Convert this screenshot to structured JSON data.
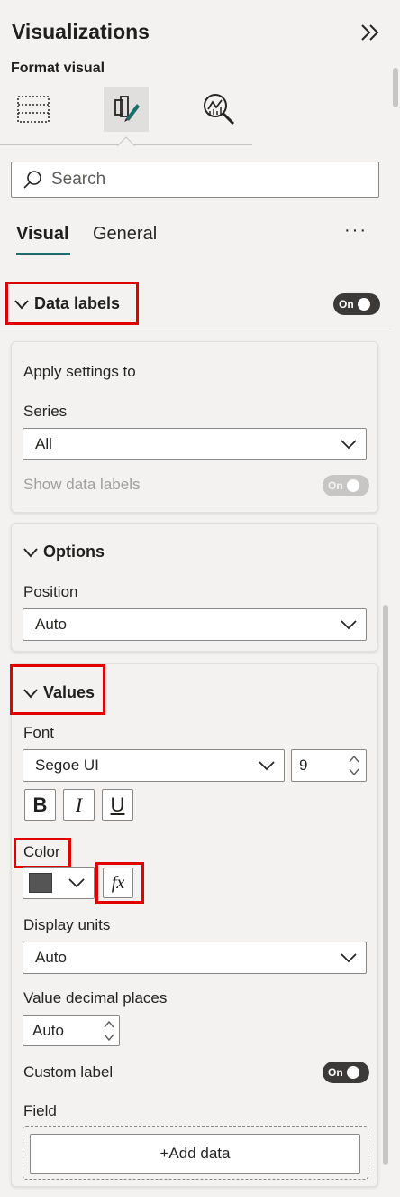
{
  "header": {
    "title": "Visualizations",
    "subtitle": "Format visual",
    "collapse_icon": "double-chevron-right-icon"
  },
  "view_icons": [
    "build-visual-grid-icon",
    "format-brush-icon",
    "analytics-magnifier-icon"
  ],
  "search": {
    "placeholder": "Search"
  },
  "format_tabs": {
    "visual": "Visual",
    "general": "General",
    "more": "···"
  },
  "data_labels": {
    "title": "Data labels",
    "toggle": "On"
  },
  "apply_settings": {
    "title": "Apply settings to",
    "series_label": "Series",
    "series_value": "All",
    "show_label": "Show data labels",
    "show_toggle": "On"
  },
  "options": {
    "title": "Options",
    "position_label": "Position",
    "position_value": "Auto"
  },
  "values": {
    "title": "Values",
    "font_label": "Font",
    "font_family": "Segoe UI",
    "font_size": "9",
    "bold": "B",
    "italic": "I",
    "underline": "U",
    "color_label": "Color",
    "color_swatch": "#555555",
    "fx": "fx",
    "display_units_label": "Display units",
    "display_units_value": "Auto",
    "decimal_label": "Value decimal places",
    "decimal_value": "Auto",
    "custom_label": "Custom label",
    "custom_toggle": "On",
    "field_label": "Field",
    "add_data": "+Add data"
  },
  "colors": {
    "accent": "#1c6e6b",
    "highlight": "#e00000",
    "toggle_on": "#3b3a39"
  }
}
